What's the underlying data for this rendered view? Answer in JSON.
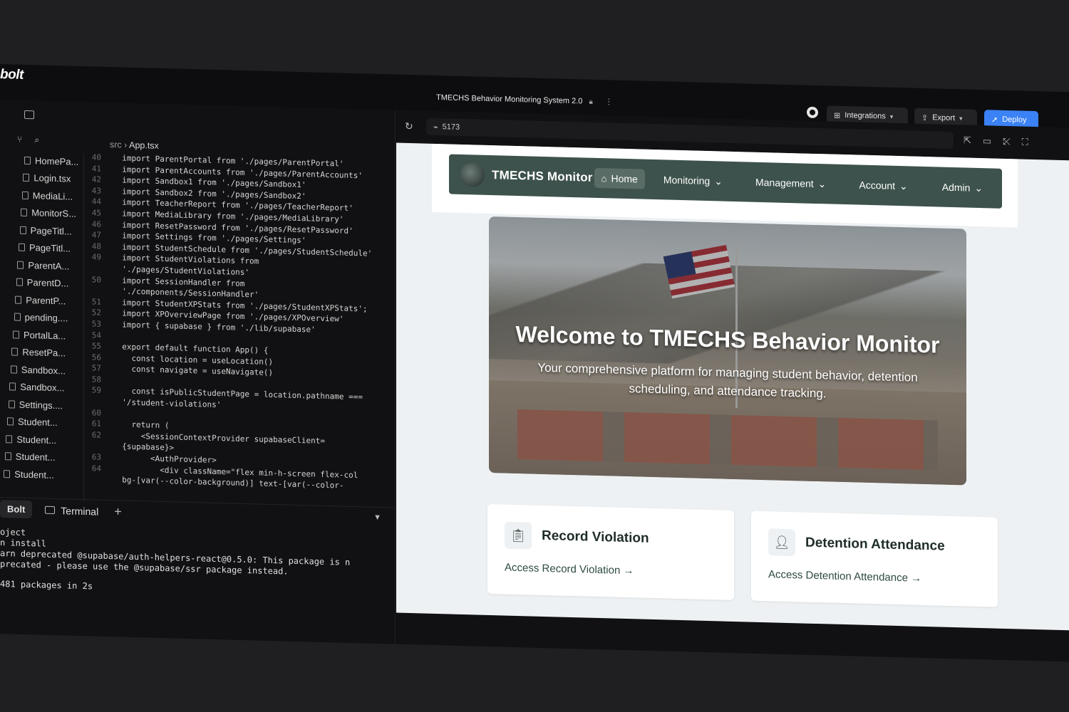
{
  "app": {
    "logo": "bolt",
    "project_title": "TMECHS Behavior Monitoring System 2.0",
    "buttons": {
      "integrations": "Integrations",
      "export": "Export",
      "deploy": "Deploy"
    }
  },
  "editor": {
    "breadcrumb_folder": "src",
    "breadcrumb_file": "App.tsx",
    "files": [
      "HomePa...",
      "Login.tsx",
      "MediaLi...",
      "MonitorS...",
      "PageTitl...",
      "PageTitl...",
      "ParentA...",
      "ParentD...",
      "ParentP...",
      "pending....",
      "PortalLa...",
      "ResetPa...",
      "Sandbox...",
      "Sandbox...",
      "Settings....",
      "Student...",
      "Student...",
      "Student...",
      "Student..."
    ],
    "code_lines": [
      {
        "n": "40",
        "t": "  import ParentPortal from './pages/ParentPortal'"
      },
      {
        "n": "41",
        "t": "  import ParentAccounts from './pages/ParentAccounts'"
      },
      {
        "n": "42",
        "t": "  import Sandbox1 from './pages/Sandbox1'"
      },
      {
        "n": "43",
        "t": "  import Sandbox2 from './pages/Sandbox2'"
      },
      {
        "n": "44",
        "t": "  import TeacherReport from './pages/TeacherReport'"
      },
      {
        "n": "45",
        "t": "  import MediaLibrary from './pages/MediaLibrary'"
      },
      {
        "n": "46",
        "t": "  import ResetPassword from './pages/ResetPassword'"
      },
      {
        "n": "47",
        "t": "  import Settings from './pages/Settings'"
      },
      {
        "n": "48",
        "t": "  import StudentSchedule from './pages/StudentSchedule'"
      },
      {
        "n": "49",
        "t": "  import StudentViolations from"
      },
      {
        "n": "",
        "t": "  './pages/StudentViolations'"
      },
      {
        "n": "50",
        "t": "  import SessionHandler from"
      },
      {
        "n": "",
        "t": "  './components/SessionHandler'"
      },
      {
        "n": "51",
        "t": "  import StudentXPStats from './pages/StudentXPStats';"
      },
      {
        "n": "52",
        "t": "  import XPOverviewPage from './pages/XPOverview'"
      },
      {
        "n": "53",
        "t": "  import { supabase } from './lib/supabase'"
      },
      {
        "n": "54",
        "t": ""
      },
      {
        "n": "55",
        "t": "  export default function App() {"
      },
      {
        "n": "56",
        "t": "    const location = useLocation()"
      },
      {
        "n": "57",
        "t": "    const navigate = useNavigate()"
      },
      {
        "n": "58",
        "t": ""
      },
      {
        "n": "59",
        "t": "    const isPublicStudentPage = location.pathname ==="
      },
      {
        "n": "",
        "t": "  '/student-violations'"
      },
      {
        "n": "60",
        "t": ""
      },
      {
        "n": "61",
        "t": "    return ("
      },
      {
        "n": "62",
        "t": "      <SessionContextProvider supabaseClient="
      },
      {
        "n": "",
        "t": "  {supabase}>"
      },
      {
        "n": "63",
        "t": "        <AuthProvider>"
      },
      {
        "n": "64",
        "t": "          <div className=\"flex min-h-screen flex-col"
      },
      {
        "n": "",
        "t": "  bg-[var(--color-background)] text-[var(--color-"
      }
    ]
  },
  "terminal": {
    "tab_bolt": "Bolt",
    "tab_terminal": "Terminal",
    "lines": [
      "oject",
      "n install",
      "arn deprecated @supabase/auth-helpers-react@0.5.0: This package is n",
      "precated - please use the @supabase/ssr package instead.",
      "",
      " 481 packages in 2s"
    ]
  },
  "preview": {
    "port": "5173",
    "nav": {
      "brand": "TMECHS Monitor",
      "home": "Home",
      "monitoring": "Monitoring",
      "management": "Management",
      "account": "Account",
      "admin": "Admin"
    },
    "hero": {
      "title": "Welcome to TMECHS Behavior Monitor",
      "subtitle": "Your comprehensive platform for managing student behavior, detention scheduling, and attendance tracking."
    },
    "cards": [
      {
        "title": "Record Violation",
        "link": "Access Record Violation →"
      },
      {
        "title": "Detention Attendance",
        "link": "Access Detention Attendance →"
      }
    ]
  },
  "colors": {
    "deploy": "#3b82f6",
    "nav_bg": "#3d524c",
    "background": "#0d0d0f"
  }
}
